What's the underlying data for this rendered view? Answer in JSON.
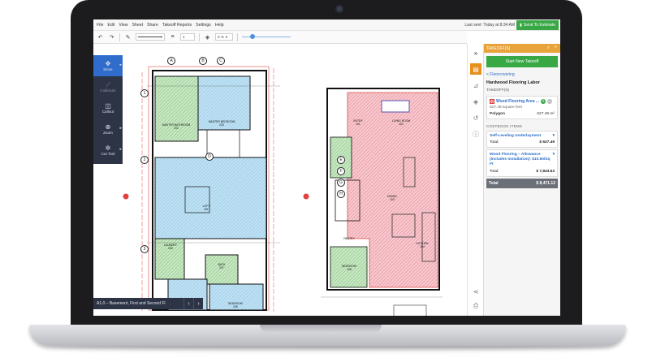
{
  "menubar": {
    "items": [
      "File",
      "Edit",
      "View",
      "Sheet",
      "Share",
      "Takeoff Reports",
      "Settings",
      "Help"
    ],
    "last_sent": "Last sent: Today at 8:34 AM",
    "send_label": "Send To Estimate"
  },
  "toolbar": {
    "line_width": "1",
    "opacity": "0 %"
  },
  "palette": {
    "tools": [
      {
        "label": "Move",
        "icon": "move-icon"
      },
      {
        "label": "Calibrator",
        "icon": "ruler-icon"
      },
      {
        "label": "Callout",
        "icon": "callout-icon"
      },
      {
        "label": "Zoom",
        "icon": "zoom-icon"
      },
      {
        "label": "Cut Tool",
        "icon": "gear-icon"
      }
    ]
  },
  "sheet": {
    "name": "A1.0 – Basement, First and Second Fl"
  },
  "plan": {
    "rooms": [
      {
        "name": "MASTER BATHROOM",
        "id": "202"
      },
      {
        "name": "MASTER BEDROOM",
        "id": "203"
      },
      {
        "name": "LOFT",
        "id": "201"
      },
      {
        "name": "LAUNDRY",
        "id": "205"
      },
      {
        "name": "BATH",
        "id": "207"
      },
      {
        "name": "BEDROOM",
        "id": "208"
      },
      {
        "name": "BEDROOM",
        "id": "206"
      },
      {
        "name": "ENTRY",
        "id": "101"
      },
      {
        "name": "LIVING ROOM",
        "id": "102"
      },
      {
        "name": "DINING",
        "id": "103"
      },
      {
        "name": "KITCHEN",
        "id": "104"
      },
      {
        "name": "PANTRY",
        "id": ""
      },
      {
        "name": "BEDROOM",
        "id": "105"
      }
    ],
    "grid_bubbles": [
      "A",
      "B",
      "C",
      "D",
      "E",
      "F",
      "G",
      "H",
      "1",
      "2",
      "3"
    ]
  },
  "panel": {
    "header": "TAKEOFF(S)",
    "start_label": "Start New Takeoff",
    "crumb": "< Floorcovering",
    "section_title": "Hardwood Flooring Labor",
    "sub_title": "TAKEOFF(S)",
    "takeoff": {
      "name": "Wood Flooring Area ...",
      "area": "627.49 square feet",
      "shape": "Polygon",
      "shape_value": "627.49 m²"
    },
    "costbook_title": "COSTBOOK ITEMS",
    "items": [
      {
        "name": "Self-Leveling Underlayment",
        "total_label": "Total:",
        "total": "$ 627.49"
      },
      {
        "name": "Wood Flooring – Allowance (Includes Installation): $10.50/Sq Ft",
        "total_label": "Total:",
        "total": "$ 7,843.63"
      }
    ],
    "grand_label": "Total",
    "grand_total": "$ 8,471.12"
  },
  "colors": {
    "accent_orange": "#e8a33a",
    "green": "#37a844",
    "palette_bg": "#2d3446",
    "link_blue": "#2d6cc6"
  }
}
